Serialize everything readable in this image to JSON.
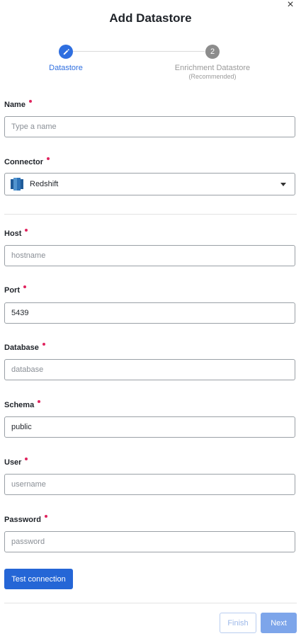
{
  "dialog": {
    "title": "Add Datastore",
    "close_label": "×"
  },
  "stepper": {
    "steps": [
      {
        "label": "Datastore",
        "state": "active",
        "icon": "pencil-icon"
      },
      {
        "number": "2",
        "label": "Enrichment Datastore",
        "sublabel": "(Recommended)",
        "state": "inactive"
      }
    ]
  },
  "form": {
    "name": {
      "label": "Name",
      "placeholder": "Type a name",
      "value": ""
    },
    "connector": {
      "label": "Connector",
      "value": "Redshift",
      "icon": "redshift-icon"
    },
    "host": {
      "label": "Host",
      "placeholder": "hostname",
      "value": ""
    },
    "port": {
      "label": "Port",
      "placeholder": "",
      "value": "5439"
    },
    "database": {
      "label": "Database",
      "placeholder": "database",
      "value": ""
    },
    "schema": {
      "label": "Schema",
      "placeholder": "",
      "value": "public"
    },
    "user": {
      "label": "User",
      "placeholder": "username",
      "value": ""
    },
    "password": {
      "label": "Password",
      "placeholder": "password",
      "value": ""
    }
  },
  "buttons": {
    "test_connection": "Test connection",
    "finish": "Finish",
    "next": "Next"
  },
  "colors": {
    "primary": "#2566d6",
    "required_dot": "#e0245e",
    "step_active": "#2f6fe0",
    "step_inactive": "#8c8c8c"
  }
}
